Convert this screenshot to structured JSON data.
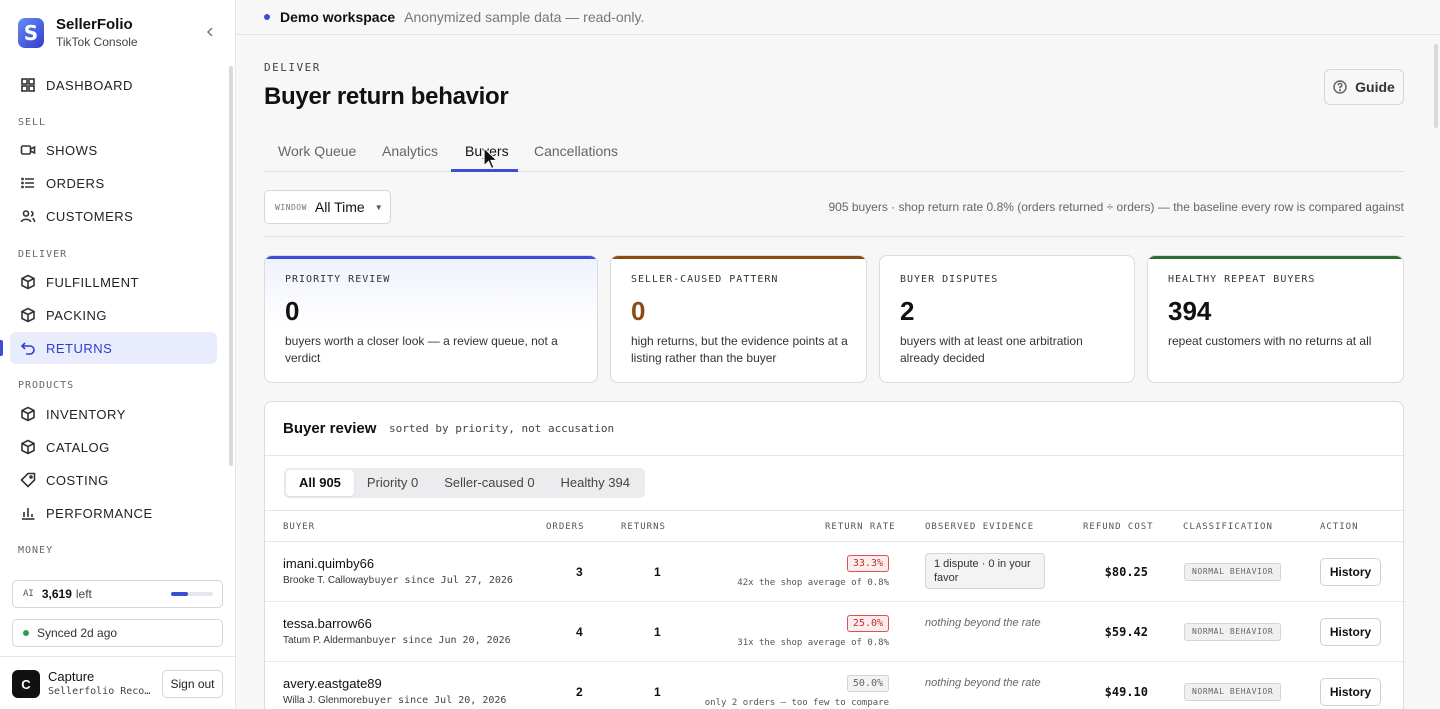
{
  "brand": {
    "name": "SellerFolio",
    "subtitle": "TikTok Console",
    "logo_letter": "S"
  },
  "sidebar": {
    "dashboard": "DASHBOARD",
    "sections": {
      "sell": "SELL",
      "deliver": "DELIVER",
      "products": "PRODUCTS",
      "money": "MONEY"
    },
    "items": {
      "shows": "SHOWS",
      "orders": "ORDERS",
      "customers": "CUSTOMERS",
      "fulfillment": "FULFILLMENT",
      "packing": "PACKING",
      "returns": "RETURNS",
      "inventory": "INVENTORY",
      "catalog": "CATALOG",
      "costing": "COSTING",
      "performance": "PERFORMANCE"
    },
    "active_item": "RETURNS",
    "ai": {
      "tag": "AI",
      "value": "3,619",
      "suffix": "left",
      "usage_fraction": 0.4
    },
    "sync": "Synced 2d ago",
    "user": {
      "initial": "C",
      "name": "Capture",
      "subtitle": "Sellerfolio Recorder",
      "signout": "Sign out"
    }
  },
  "banner": {
    "title": "Demo workspace",
    "subtitle": "Anonymized sample data — read-only."
  },
  "header": {
    "eyebrow": "DELIVER",
    "title": "Buyer return behavior",
    "guide": "Guide"
  },
  "tabs": [
    "Work Queue",
    "Analytics",
    "Buyers",
    "Cancellations"
  ],
  "active_tab": "Buyers",
  "filters": {
    "window_tag": "WINDOW",
    "window_value": "All Time",
    "summary": "905 buyers · shop return rate 0.8% (orders returned ÷ orders) — the baseline every row is compared against"
  },
  "cards": [
    {
      "label": "PRIORITY REVIEW",
      "value": "0",
      "desc": "buyers worth a closer look — a review queue, not a verdict",
      "accent": "#3b4fd6"
    },
    {
      "label": "SELLER-CAUSED PATTERN",
      "value": "0",
      "desc": "high returns, but the evidence points at a listing rather than the buyer",
      "accent": "#8a4b14"
    },
    {
      "label": "BUYER DISPUTES",
      "value": "2",
      "desc": "buyers with at least one arbitration already decided",
      "accent": ""
    },
    {
      "label": "HEALTHY REPEAT BUYERS",
      "value": "394",
      "desc": "repeat customers with no returns at all",
      "accent": "#2e6b35"
    }
  ],
  "review": {
    "title": "Buyer review",
    "subtitle": "sorted by priority, not accusation",
    "segments": [
      "All 905",
      "Priority 0",
      "Seller-caused 0",
      "Healthy 394"
    ],
    "active_segment": "All 905",
    "columns": {
      "buyer": "BUYER",
      "orders": "ORDERS",
      "returns": "RETURNS",
      "rate": "RETURN RATE",
      "evidence": "OBSERVED EVIDENCE",
      "refund": "REFUND COST",
      "classification": "CLASSIFICATION",
      "action": "ACTION"
    },
    "rows": [
      {
        "handle": "imani.quimby66",
        "real_name": "Brooke T. Calloway",
        "since": "buyer since Jul 27, 2026",
        "orders": "3",
        "returns": "1",
        "rate": "33.3%",
        "rate_note": "42x the shop average of 0.8%",
        "evidence": "1 dispute · 0 in your favor",
        "refund": "$80.25",
        "classification": "NORMAL BEHAVIOR",
        "action": "History"
      },
      {
        "handle": "tessa.barrow66",
        "real_name": "Tatum P. Alderman",
        "since": "buyer since Jun 20, 2026",
        "orders": "4",
        "returns": "1",
        "rate": "25.0%",
        "rate_note": "31x the shop average of 0.8%",
        "evidence": "nothing beyond the rate",
        "refund": "$59.42",
        "classification": "NORMAL BEHAVIOR",
        "action": "History"
      },
      {
        "handle": "avery.eastgate89",
        "real_name": "Willa J. Glenmore",
        "since": "buyer since Jul 20, 2026",
        "orders": "2",
        "returns": "1",
        "rate": "50.0%",
        "rate_note": "only 2 orders — too few to compare",
        "evidence": "nothing beyond the rate",
        "refund": "$49.10",
        "classification": "NORMAL BEHAVIOR",
        "action": "History"
      }
    ]
  }
}
